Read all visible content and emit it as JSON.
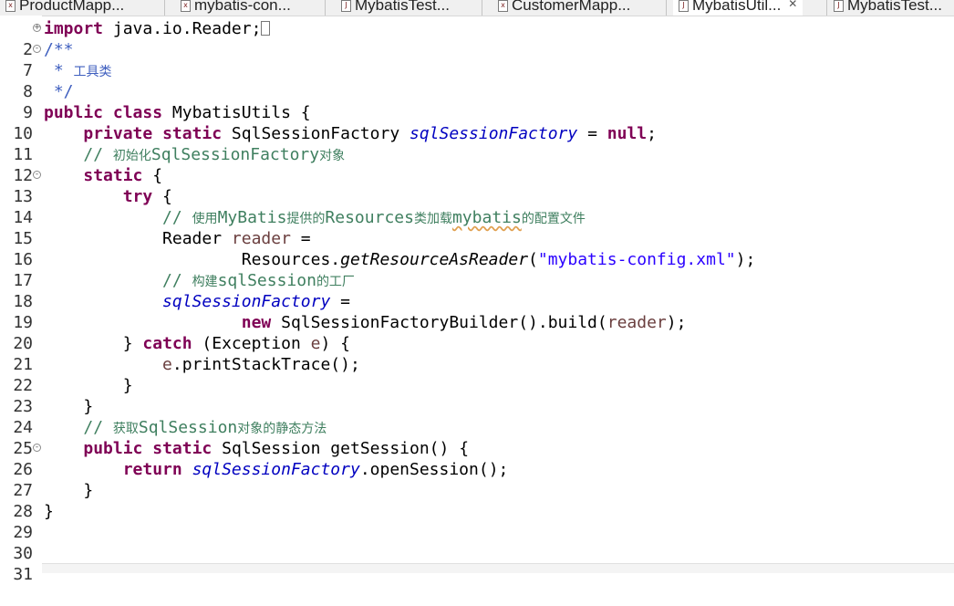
{
  "tabs": [
    {
      "label": "ProductMapp...",
      "active": false
    },
    {
      "label": "mybatis-con...",
      "active": false
    },
    {
      "label": "MybatisTest...",
      "active": false
    },
    {
      "label": "CustomerMapp...",
      "active": false
    },
    {
      "label": "MybatisUtil...",
      "active": true,
      "close": "✕"
    },
    {
      "label": "MybatisTest...",
      "active": false
    }
  ],
  "editor": {
    "lines": [
      {
        "n": "2",
        "fold": "+"
      },
      {
        "n": "7",
        "fold": "-"
      },
      {
        "n": "8"
      },
      {
        "n": "9"
      },
      {
        "n": "10"
      },
      {
        "n": "11"
      },
      {
        "n": "12"
      },
      {
        "n": "13",
        "fold": "-"
      },
      {
        "n": "14"
      },
      {
        "n": "15"
      },
      {
        "n": "16"
      },
      {
        "n": "17"
      },
      {
        "n": "18"
      },
      {
        "n": "19"
      },
      {
        "n": "20"
      },
      {
        "n": "21"
      },
      {
        "n": "22"
      },
      {
        "n": "23"
      },
      {
        "n": "24"
      },
      {
        "n": "25"
      },
      {
        "n": "26",
        "fold": "-"
      },
      {
        "n": "27"
      },
      {
        "n": "28"
      },
      {
        "n": "29"
      },
      {
        "n": "30"
      },
      {
        "n": "31"
      }
    ],
    "t": {
      "import": "import",
      "import_path": " java.io.Reader;",
      "jd_open": "/**",
      "jd_star": " * ",
      "jd_text": "工具类",
      "jd_close": " */",
      "public": "public",
      "class": "class",
      "class_name": " MybatisUtils {",
      "private": "private",
      "static": "static",
      "factory_type": " SqlSessionFactory ",
      "factory_field": "sqlSessionFactory",
      "assign": " = ",
      "null": "null",
      "semi": ";",
      "c12_slash": "// ",
      "c12_a": "初始化",
      "c12_b": "SqlSessionFactory",
      "c12_c": "对象",
      "static_open": " {",
      "try": "try",
      "brace_open": " {",
      "c15_slash": "// ",
      "c15_a": "使用",
      "c15_b": "MyBatis",
      "c15_c": "提供的",
      "c15_d": "Resources",
      "c15_e": "类加载",
      "c15_f": "mybatis",
      "c15_g": "的配置文件",
      "reader_type": "Reader ",
      "reader_var": "reader",
      "assign2": " =",
      "resources": "Resources.",
      "get_method": "getResourceAsReader",
      "paren_open": "(",
      "config_str": "\"mybatis-config.xml\"",
      "paren_close": ");",
      "c18_slash": "// ",
      "c18_a": "构建",
      "c18_b": "sqlSession",
      "c18_c": "的工厂",
      "factory_field2": "sqlSessionFactory",
      "assign3": " =",
      "new": "new",
      "builder": " SqlSessionFactoryBuilder().build(",
      "reader_var2": "reader",
      "build_close": ");",
      "close_brace": "} ",
      "catch": "catch",
      "catch_open": " (Exception ",
      "e_var": "e",
      "catch_close": ") {",
      "e_var2": "e",
      "print_trace": ".printStackTrace();",
      "brace": "}",
      "c25_slash": "// ",
      "c25_a": "获取",
      "c25_b": "SqlSession",
      "c25_c": "对象的静态方法",
      "get_session": " SqlSession getSession() {",
      "return": "return",
      "factory_field3": "sqlSessionFactory",
      "open_session": ".openSession();"
    }
  }
}
